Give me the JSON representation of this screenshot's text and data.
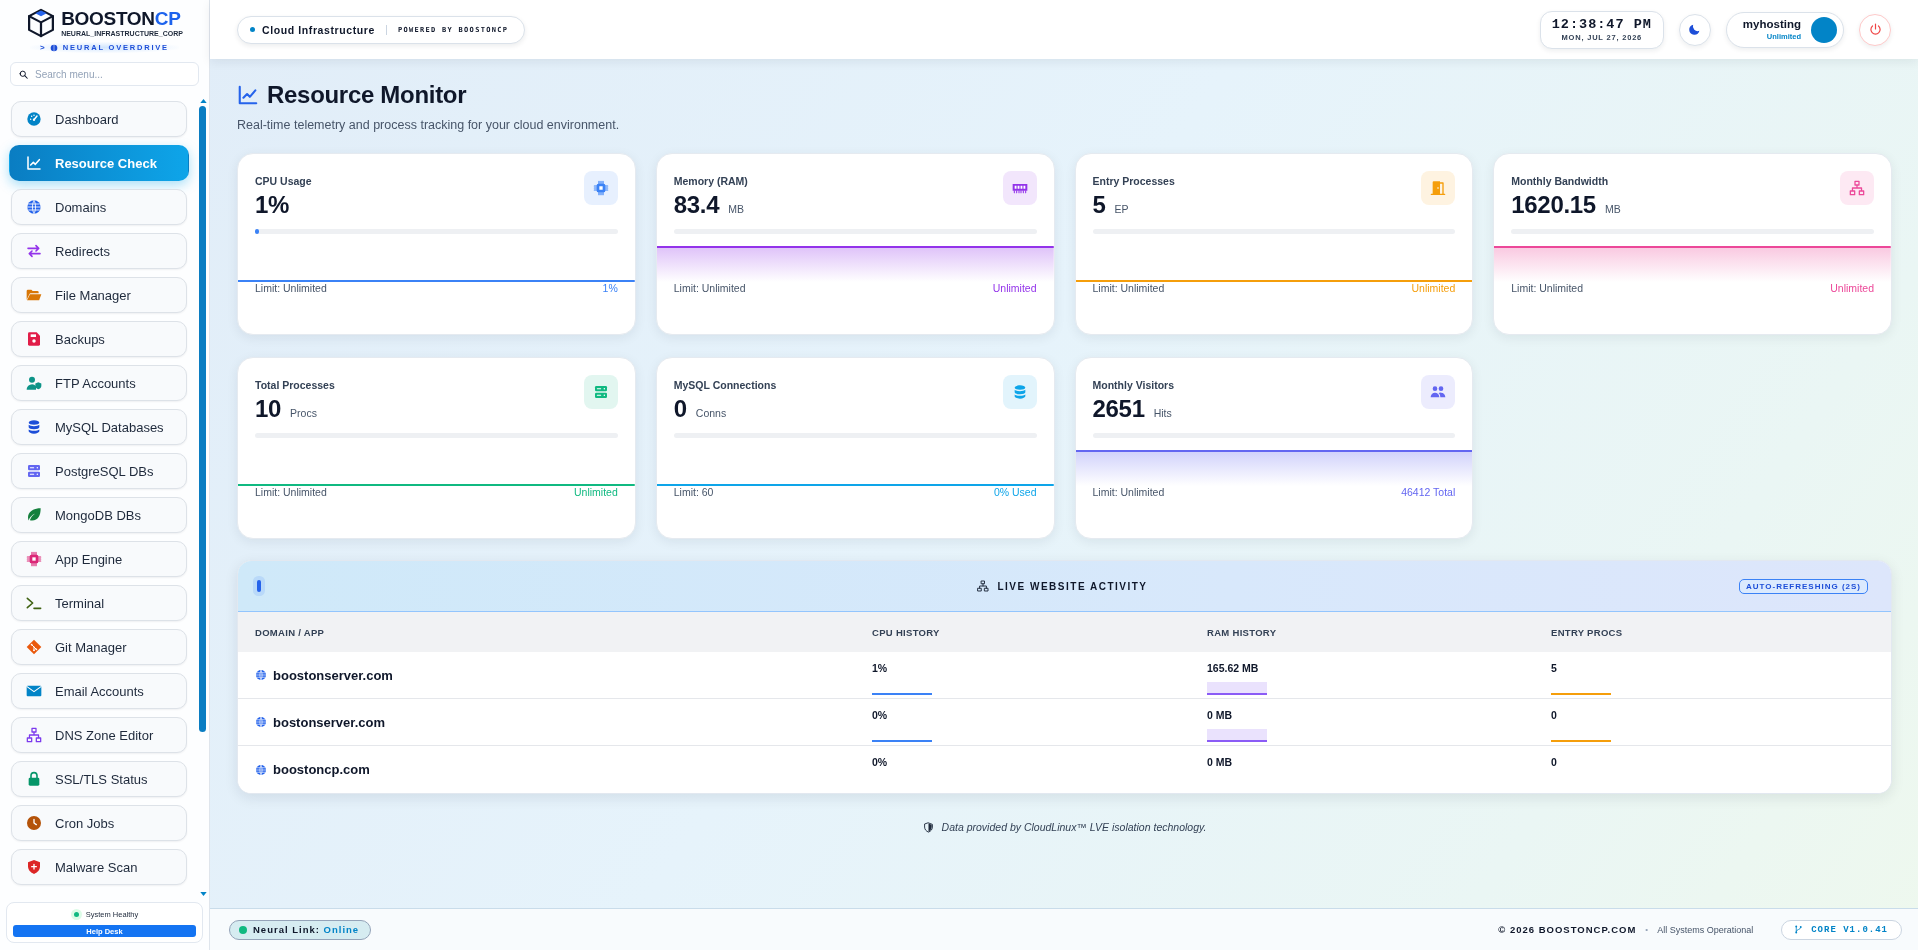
{
  "sidebar": {
    "brand": {
      "name": "BOOSTON",
      "accent": "CP",
      "tagline": "NEURAL_INFRASTRUCTURE_CORP",
      "prompt": ">",
      "mode": "NEURAL OVERDRIVE"
    },
    "search": {
      "placeholder": "Search menu..."
    },
    "items": [
      {
        "label": "Dashboard",
        "selected": false
      },
      {
        "label": "Resource Check",
        "selected": true
      },
      {
        "label": "Domains",
        "selected": false
      },
      {
        "label": "Redirects",
        "selected": false
      },
      {
        "label": "File Manager",
        "selected": false
      },
      {
        "label": "Backups",
        "selected": false
      },
      {
        "label": "FTP Accounts",
        "selected": false
      },
      {
        "label": "MySQL Databases",
        "selected": false
      },
      {
        "label": "PostgreSQL DBs",
        "selected": false
      },
      {
        "label": "MongoDB DBs",
        "selected": false
      },
      {
        "label": "App Engine",
        "selected": false
      },
      {
        "label": "Terminal",
        "selected": false
      },
      {
        "label": "Git Manager",
        "selected": false
      },
      {
        "label": "Email Accounts",
        "selected": false
      },
      {
        "label": "DNS Zone Editor",
        "selected": false
      },
      {
        "label": "SSL/TLS Status",
        "selected": false
      },
      {
        "label": "Cron Jobs",
        "selected": false
      },
      {
        "label": "Malware Scan",
        "selected": false
      }
    ],
    "health": "System Healthy",
    "help_button": "Help Desk"
  },
  "header": {
    "context": "Cloud Infrastructure",
    "powered_by": "POWERED BY BOOSTONCP",
    "time": "12:38:47 PM",
    "date": "MON, JUL 27, 2026",
    "user": {
      "name": "myhosting",
      "plan": "Unlimited"
    }
  },
  "page": {
    "title": "Resource Monitor",
    "subtitle": "Real-time telemetry and process tracking for your cloud environment."
  },
  "metrics": [
    {
      "label": "CPU Usage",
      "value": "1%",
      "level": 0.01,
      "limit": "Limit: Unlimited",
      "reading": "1%",
      "color": "#3b82f6",
      "kind": "line"
    },
    {
      "label": "Memory (RAM)",
      "value": "83.4",
      "unit": "MB",
      "level": 0,
      "limit": "Limit: Unlimited",
      "reading": "Unlimited",
      "color": "#9333ea",
      "kind": "area"
    },
    {
      "label": "Entry Processes",
      "value": "5",
      "unit": "EP",
      "level": 0,
      "limit": "Limit: Unlimited",
      "reading": "Unlimited",
      "color": "#f59e0b",
      "kind": "line"
    },
    {
      "label": "Monthly Bandwidth",
      "value": "1620.15",
      "unit": "MB",
      "level": 0,
      "limit": "Limit: Unlimited",
      "reading": "Unlimited",
      "color": "#ec4899",
      "kind": "area"
    },
    {
      "label": "Total Processes",
      "value": "10",
      "unit": "Procs",
      "level": 0,
      "limit": "Limit: Unlimited",
      "reading": "Unlimited",
      "color": "#10b981",
      "kind": "line"
    },
    {
      "label": "MySQL Connections",
      "value": "0",
      "unit": "Conns",
      "level": 0,
      "limit": "Limit: 60",
      "reading": "0% Used",
      "color": "#0ea5e9",
      "kind": "line"
    },
    {
      "label": "Monthly Visitors",
      "value": "2651",
      "unit": "Hits",
      "level": 0,
      "limit": "Limit: Unlimited",
      "reading": "46412 Total",
      "color": "#6366f1",
      "kind": "area"
    }
  ],
  "activity": {
    "title": "LIVE WEBSITE ACTIVITY",
    "badge": "AUTO-REFRESHING (2S)",
    "columns": [
      "DOMAIN / APP",
      "CPU HISTORY",
      "RAM HISTORY",
      "ENTRY PROCS"
    ],
    "rows": [
      {
        "domain": "boostonserver.com",
        "cpu": "1%",
        "ram": "165.62 MB",
        "entry_procs": "5",
        "history": true
      },
      {
        "domain": "bostonserver.com",
        "cpu": "0%",
        "ram": "0 MB",
        "entry_procs": "0",
        "history": true
      },
      {
        "domain": "boostoncp.com",
        "cpu": "0%",
        "ram": "0 MB",
        "entry_procs": "0",
        "history": false
      }
    ]
  },
  "footnote": "Data provided by CloudLinux™ LVE isolation technology.",
  "status_bar": {
    "link_label": "Neural Link:",
    "link_state": "Online",
    "copyright": "© 2026 BOOSTONCP.COM",
    "separator": "•",
    "system_status": "All Systems Operational",
    "version": "CORE V1.0.41"
  }
}
